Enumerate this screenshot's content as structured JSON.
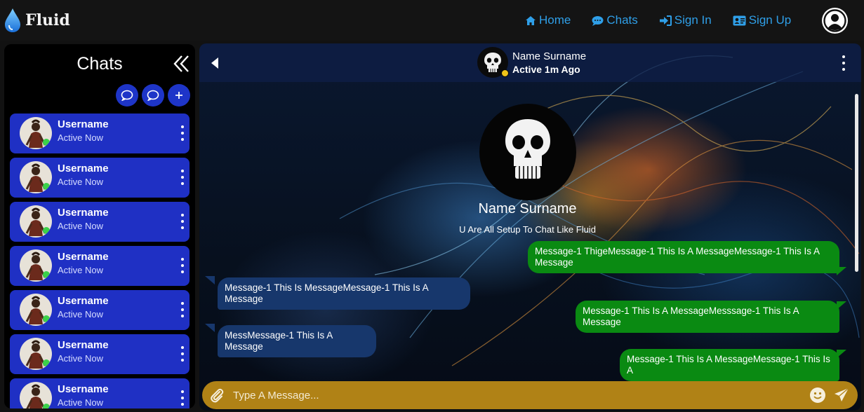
{
  "navbar": {
    "brand": "Fluid",
    "links": [
      {
        "label": "Home",
        "icon": "home-icon"
      },
      {
        "label": "Chats",
        "icon": "chat-bubble-icon"
      },
      {
        "label": "Sign In",
        "icon": "sign-in-icon"
      },
      {
        "label": "Sign Up",
        "icon": "id-card-icon"
      }
    ],
    "profile_icon": "user-circle-icon"
  },
  "sidebar": {
    "title": "Chats",
    "collapse_icon": "double-chevron-left-icon",
    "actions": [
      "chat-bubble-icon",
      "chat-bubble-icon",
      "plus-icon"
    ],
    "items": [
      {
        "name": "Username",
        "status": "Active Now"
      },
      {
        "name": "Username",
        "status": "Active Now"
      },
      {
        "name": "Username",
        "status": "Active Now"
      },
      {
        "name": "Username",
        "status": "Active Now"
      },
      {
        "name": "Username",
        "status": "Active Now"
      },
      {
        "name": "Username",
        "status": "Active Now"
      },
      {
        "name": "Username",
        "status": "Active Now"
      }
    ]
  },
  "chat": {
    "header": {
      "name": "Name Surname",
      "status": "Active 1m Ago"
    },
    "profile": {
      "name": "Name Surname",
      "subtitle": "U Are All Setup To Chat Like Fluid"
    },
    "messages": [
      {
        "direction": "out",
        "text": "Message-1 ThigeMessage-1 This Is A MessageMessage-1 This Is A Message"
      },
      {
        "direction": "in",
        "text": "Message-1 This Is MessageMessage-1 This Is A Message"
      },
      {
        "direction": "out",
        "text": "Message-1 This Is A MessageMesssage-1 This Is A Message"
      },
      {
        "direction": "in",
        "text": "MessMessage-1 This Is A Message"
      },
      {
        "direction": "out",
        "text": "Message-1 This Is A MessageMessage-1 This Is A"
      }
    ],
    "input": {
      "placeholder": "Type A Message..."
    },
    "colors": {
      "outgoing": "#0a8a12",
      "incoming": "#17376c",
      "input_bar": "#b08216",
      "chat_item": "#1f30c4",
      "nav_link": "#2f9fe8"
    }
  }
}
